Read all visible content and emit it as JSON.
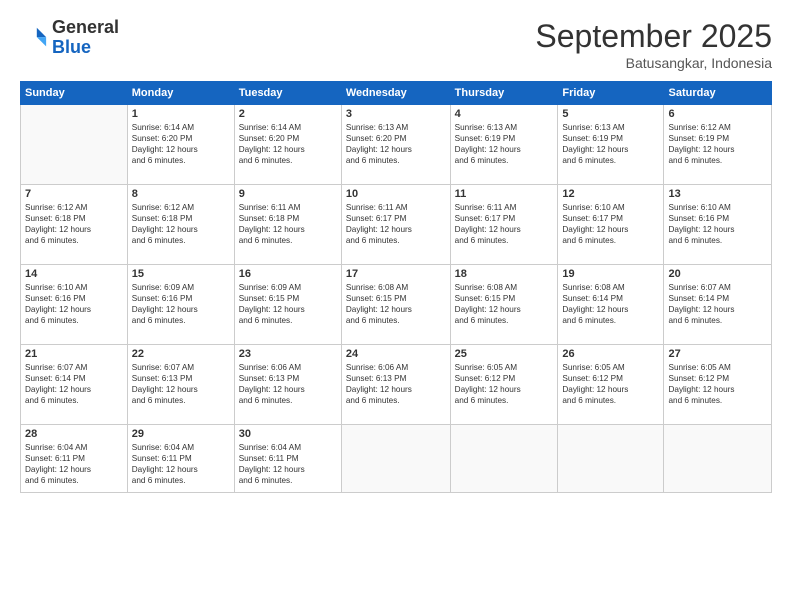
{
  "logo": {
    "general": "General",
    "blue": "Blue"
  },
  "header": {
    "month": "September 2025",
    "location": "Batusangkar, Indonesia"
  },
  "days_of_week": [
    "Sunday",
    "Monday",
    "Tuesday",
    "Wednesday",
    "Thursday",
    "Friday",
    "Saturday"
  ],
  "weeks": [
    [
      {
        "day": "",
        "info": ""
      },
      {
        "day": "1",
        "info": "Sunrise: 6:14 AM\nSunset: 6:20 PM\nDaylight: 12 hours\nand 6 minutes."
      },
      {
        "day": "2",
        "info": "Sunrise: 6:14 AM\nSunset: 6:20 PM\nDaylight: 12 hours\nand 6 minutes."
      },
      {
        "day": "3",
        "info": "Sunrise: 6:13 AM\nSunset: 6:20 PM\nDaylight: 12 hours\nand 6 minutes."
      },
      {
        "day": "4",
        "info": "Sunrise: 6:13 AM\nSunset: 6:19 PM\nDaylight: 12 hours\nand 6 minutes."
      },
      {
        "day": "5",
        "info": "Sunrise: 6:13 AM\nSunset: 6:19 PM\nDaylight: 12 hours\nand 6 minutes."
      },
      {
        "day": "6",
        "info": "Sunrise: 6:12 AM\nSunset: 6:19 PM\nDaylight: 12 hours\nand 6 minutes."
      }
    ],
    [
      {
        "day": "7",
        "info": "Sunrise: 6:12 AM\nSunset: 6:18 PM\nDaylight: 12 hours\nand 6 minutes."
      },
      {
        "day": "8",
        "info": "Sunrise: 6:12 AM\nSunset: 6:18 PM\nDaylight: 12 hours\nand 6 minutes."
      },
      {
        "day": "9",
        "info": "Sunrise: 6:11 AM\nSunset: 6:18 PM\nDaylight: 12 hours\nand 6 minutes."
      },
      {
        "day": "10",
        "info": "Sunrise: 6:11 AM\nSunset: 6:17 PM\nDaylight: 12 hours\nand 6 minutes."
      },
      {
        "day": "11",
        "info": "Sunrise: 6:11 AM\nSunset: 6:17 PM\nDaylight: 12 hours\nand 6 minutes."
      },
      {
        "day": "12",
        "info": "Sunrise: 6:10 AM\nSunset: 6:17 PM\nDaylight: 12 hours\nand 6 minutes."
      },
      {
        "day": "13",
        "info": "Sunrise: 6:10 AM\nSunset: 6:16 PM\nDaylight: 12 hours\nand 6 minutes."
      }
    ],
    [
      {
        "day": "14",
        "info": "Sunrise: 6:10 AM\nSunset: 6:16 PM\nDaylight: 12 hours\nand 6 minutes."
      },
      {
        "day": "15",
        "info": "Sunrise: 6:09 AM\nSunset: 6:16 PM\nDaylight: 12 hours\nand 6 minutes."
      },
      {
        "day": "16",
        "info": "Sunrise: 6:09 AM\nSunset: 6:15 PM\nDaylight: 12 hours\nand 6 minutes."
      },
      {
        "day": "17",
        "info": "Sunrise: 6:08 AM\nSunset: 6:15 PM\nDaylight: 12 hours\nand 6 minutes."
      },
      {
        "day": "18",
        "info": "Sunrise: 6:08 AM\nSunset: 6:15 PM\nDaylight: 12 hours\nand 6 minutes."
      },
      {
        "day": "19",
        "info": "Sunrise: 6:08 AM\nSunset: 6:14 PM\nDaylight: 12 hours\nand 6 minutes."
      },
      {
        "day": "20",
        "info": "Sunrise: 6:07 AM\nSunset: 6:14 PM\nDaylight: 12 hours\nand 6 minutes."
      }
    ],
    [
      {
        "day": "21",
        "info": "Sunrise: 6:07 AM\nSunset: 6:14 PM\nDaylight: 12 hours\nand 6 minutes."
      },
      {
        "day": "22",
        "info": "Sunrise: 6:07 AM\nSunset: 6:13 PM\nDaylight: 12 hours\nand 6 minutes."
      },
      {
        "day": "23",
        "info": "Sunrise: 6:06 AM\nSunset: 6:13 PM\nDaylight: 12 hours\nand 6 minutes."
      },
      {
        "day": "24",
        "info": "Sunrise: 6:06 AM\nSunset: 6:13 PM\nDaylight: 12 hours\nand 6 minutes."
      },
      {
        "day": "25",
        "info": "Sunrise: 6:05 AM\nSunset: 6:12 PM\nDaylight: 12 hours\nand 6 minutes."
      },
      {
        "day": "26",
        "info": "Sunrise: 6:05 AM\nSunset: 6:12 PM\nDaylight: 12 hours\nand 6 minutes."
      },
      {
        "day": "27",
        "info": "Sunrise: 6:05 AM\nSunset: 6:12 PM\nDaylight: 12 hours\nand 6 minutes."
      }
    ],
    [
      {
        "day": "28",
        "info": "Sunrise: 6:04 AM\nSunset: 6:11 PM\nDaylight: 12 hours\nand 6 minutes."
      },
      {
        "day": "29",
        "info": "Sunrise: 6:04 AM\nSunset: 6:11 PM\nDaylight: 12 hours\nand 6 minutes."
      },
      {
        "day": "30",
        "info": "Sunrise: 6:04 AM\nSunset: 6:11 PM\nDaylight: 12 hours\nand 6 minutes."
      },
      {
        "day": "",
        "info": ""
      },
      {
        "day": "",
        "info": ""
      },
      {
        "day": "",
        "info": ""
      },
      {
        "day": "",
        "info": ""
      }
    ]
  ]
}
